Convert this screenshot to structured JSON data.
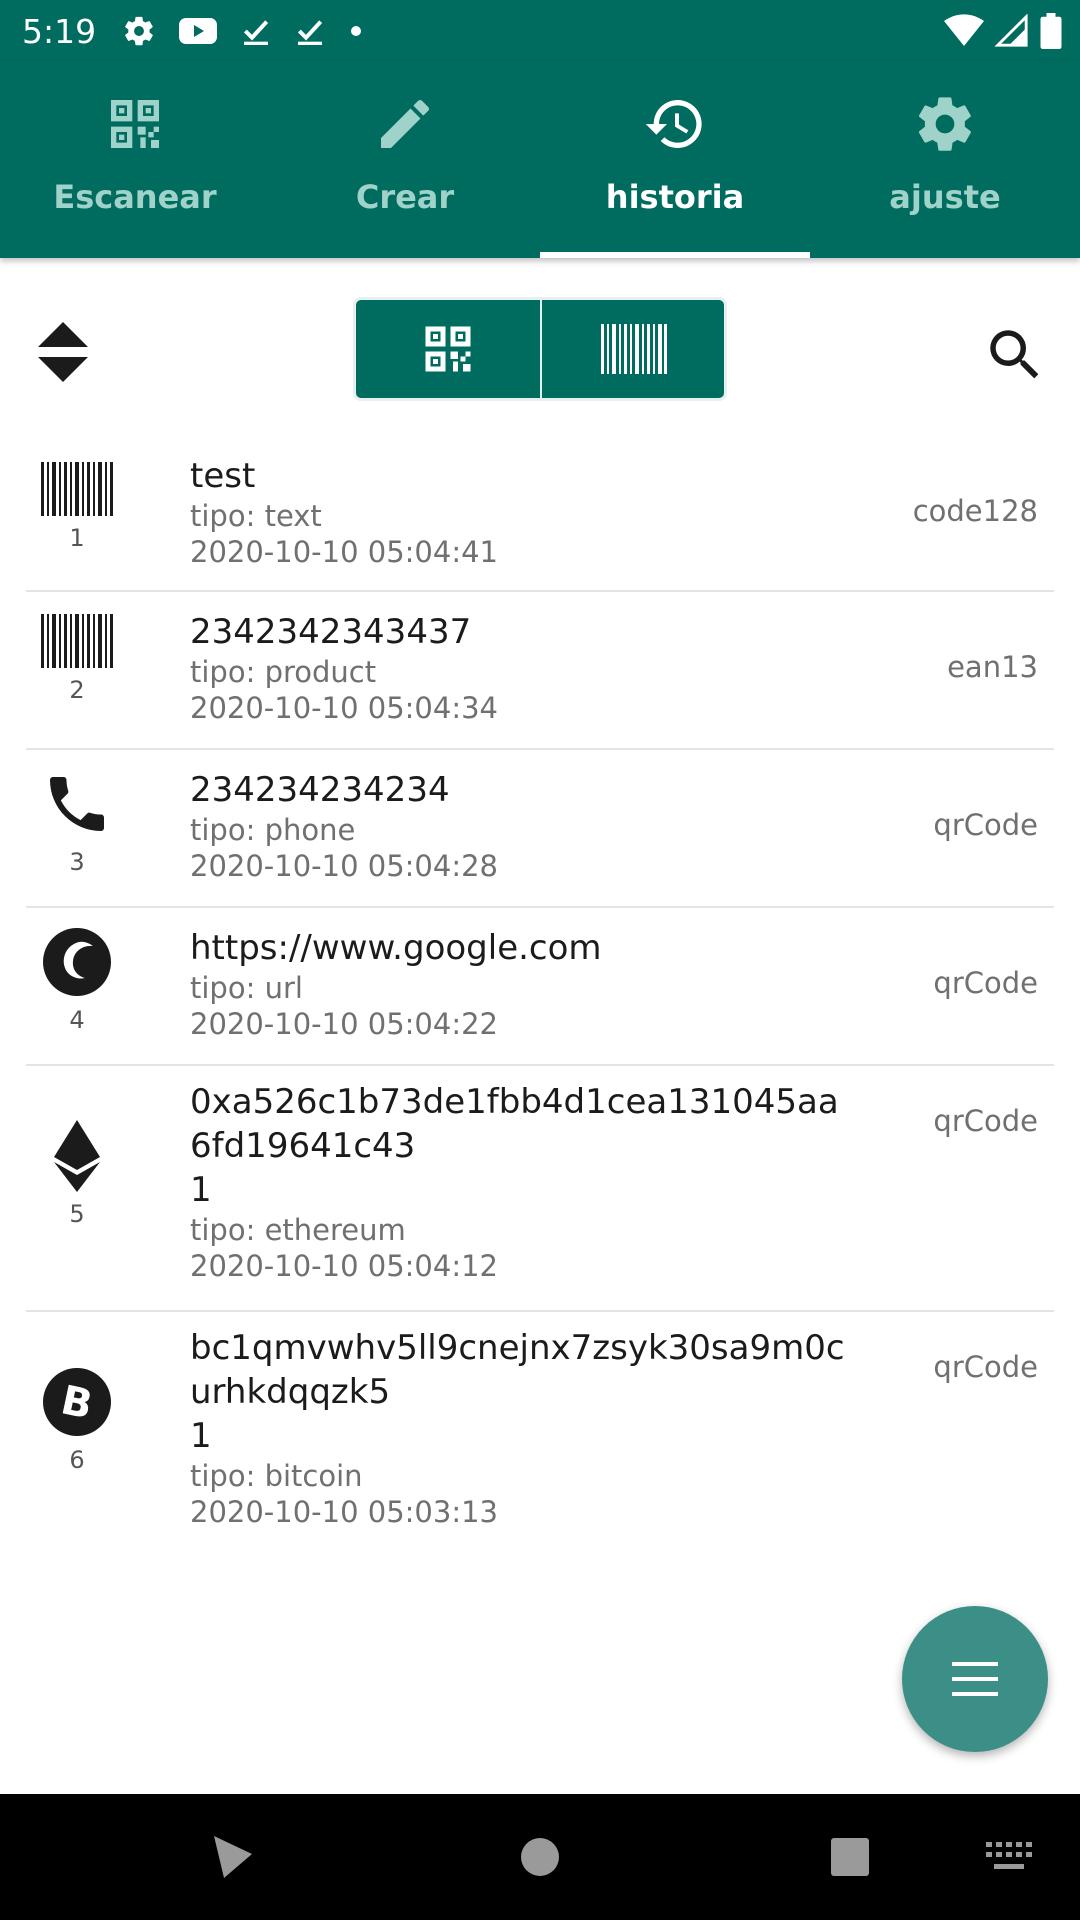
{
  "status_bar": {
    "time": "5:19",
    "left_icons": [
      "settings-icon",
      "youtube-icon",
      "check-icon",
      "check-icon",
      "dot-icon"
    ],
    "right_icons": [
      "wifi-icon",
      "signal-icon",
      "battery-icon"
    ]
  },
  "tabs": [
    {
      "label": "Escanear",
      "icon": "qr-code-icon",
      "active": false
    },
    {
      "label": "Crear",
      "icon": "pencil-icon",
      "active": false
    },
    {
      "label": "historia",
      "icon": "history-icon",
      "active": true
    },
    {
      "label": "ajuste",
      "icon": "gear-icon",
      "active": false
    }
  ],
  "toolbar": {
    "sort_icon": "sort-icon",
    "filter_options": [
      "qr-code-filter",
      "barcode-filter"
    ],
    "search_icon": "search-icon"
  },
  "history": [
    {
      "index": "1",
      "icon": "barcode-icon",
      "title": "test",
      "type": "tipo: text",
      "date": "2020-10-10 05:04:41",
      "format": "code128"
    },
    {
      "index": "2",
      "icon": "barcode-icon",
      "title": "2342342343437",
      "type": "tipo: product",
      "date": "2020-10-10 05:04:34",
      "format": "ean13"
    },
    {
      "index": "3",
      "icon": "phone-icon",
      "title": "234234234234",
      "type": "tipo: phone",
      "date": "2020-10-10 05:04:28",
      "format": "qrCode"
    },
    {
      "index": "4",
      "icon": "globe-icon",
      "title": "https://www.google.com",
      "type": "tipo: url",
      "date": "2020-10-10 05:04:22",
      "format": "qrCode"
    },
    {
      "index": "5",
      "icon": "ethereum-icon",
      "title_line1": "0xa526c1b73de1fbb4d1cea131045aa",
      "title_line2": "6fd19641c43",
      "title_line3": "1",
      "type": "tipo: ethereum",
      "date": "2020-10-10 05:04:12",
      "format": "qrCode"
    },
    {
      "index": "6",
      "icon": "bitcoin-icon",
      "title_line1": "bc1qmvwhv5ll9cnejnx7zsyk30sa9m0c",
      "title_line2": "urhkdqqzk5",
      "title_line3": "1",
      "type": "tipo: bitcoin",
      "date": "2020-10-10 05:03:13",
      "format": "qrCode"
    }
  ],
  "fab": {
    "icon": "menu-icon"
  },
  "nav_bar": {
    "icons": [
      "back-icon",
      "home-icon",
      "recents-icon",
      "keyboard-icon"
    ]
  },
  "colors": {
    "primary": "#006b5f",
    "accent": "#3b8f86",
    "inactive_tab": "#9fd2c8"
  }
}
